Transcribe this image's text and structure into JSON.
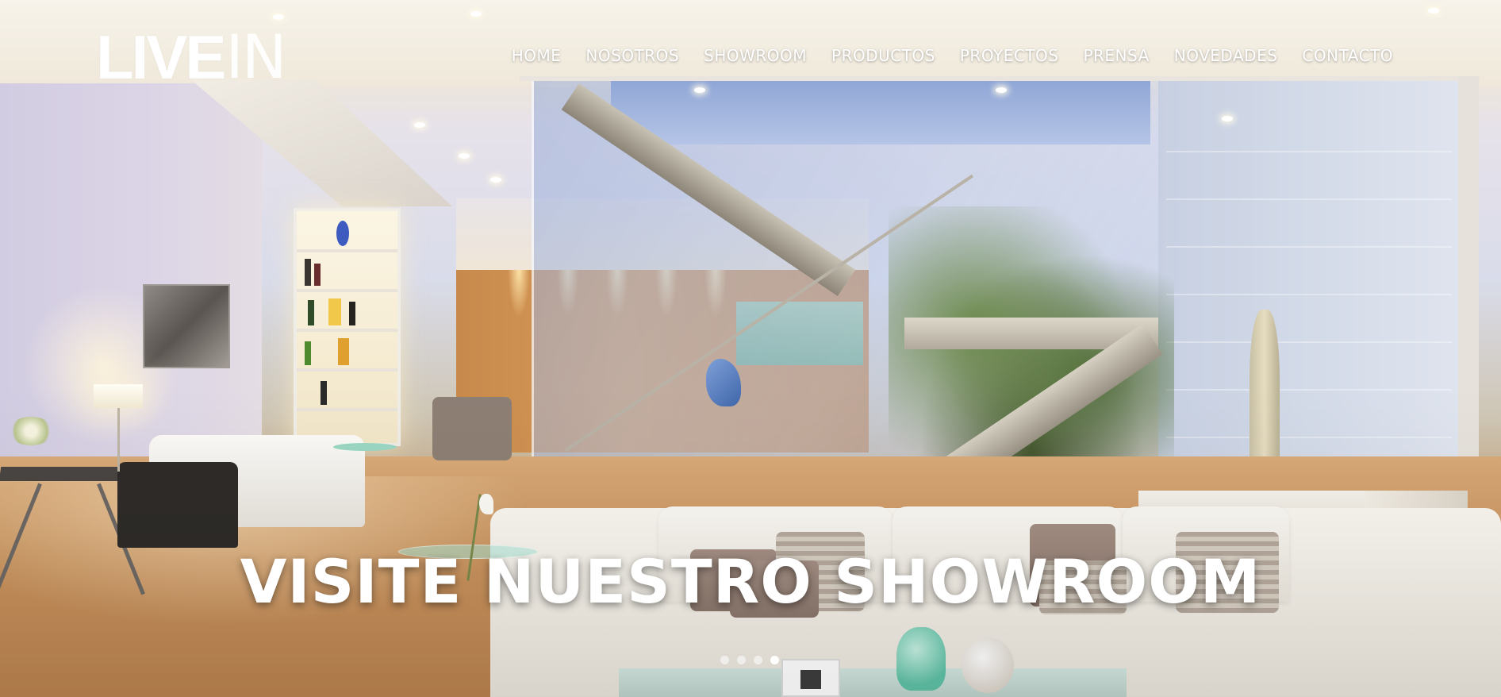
{
  "brand": {
    "logo_bold": "LIVE",
    "logo_thin": "IN"
  },
  "nav": {
    "items": [
      {
        "label": "HOME"
      },
      {
        "label": "NOSOTROS"
      },
      {
        "label": "SHOWROOM"
      },
      {
        "label": "PRODUCTOS"
      },
      {
        "label": "PROYECTOS"
      },
      {
        "label": "PRENSA"
      },
      {
        "label": "NOVEDADES"
      },
      {
        "label": "CONTACTO"
      }
    ]
  },
  "hero": {
    "title": "VISITE NUESTRO SHOWROOM",
    "image_alt_icon": "showroom-interior-photo",
    "slider": {
      "slide_count": 4,
      "active_index": 3
    }
  },
  "colors": {
    "text": "#ffffff",
    "accent_teal": "#5fc2a6",
    "wood": "#c88a4c"
  }
}
